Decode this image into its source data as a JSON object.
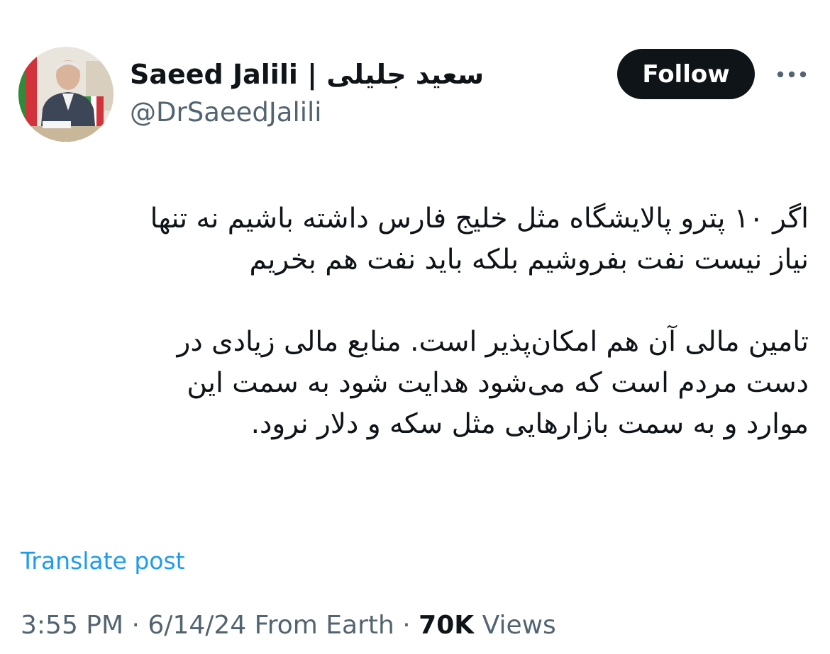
{
  "author": {
    "display_name": "Saeed Jalili | سعید جلیلی",
    "handle": "@DrSaeedJalili",
    "avatar_icon": "profile-photo"
  },
  "actions": {
    "follow_label": "Follow",
    "more_icon": "more-options-icon"
  },
  "tweet": {
    "direction": "rtl",
    "paragraphs": [
      "اگر ۱۰ پترو پالایشگاه مثل خلیج فارس داشته باشیم نه تنها\nنیاز نیست نفت بفروشیم بلکه باید نفت هم بخریم",
      "تامین مالی آن هم امکان‌پذیر است. منابع مالی زیادی در\nدست مردم است که می‌شود هدایت شود به سمت این\nموارد و به سمت بازارهایی مثل سکه و دلار نرود."
    ]
  },
  "translate_label": "Translate post",
  "meta": {
    "time": "3:55 PM",
    "separator": " · ",
    "date": "6/14/24",
    "source": "From Earth",
    "views_count": "70K",
    "views_label": "Views"
  },
  "colors": {
    "text": "#0f1419",
    "secondary": "#536471",
    "link": "#1d9bf0",
    "button_bg": "#0f1419",
    "button_text": "#ffffff"
  }
}
